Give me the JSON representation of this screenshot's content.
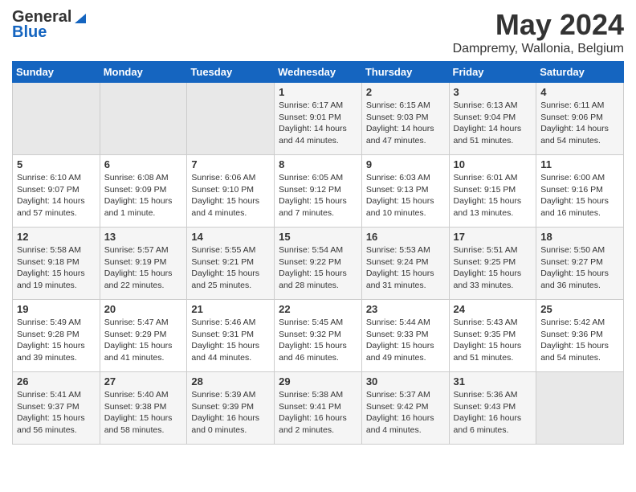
{
  "header": {
    "logo_general": "General",
    "logo_blue": "Blue",
    "month_title": "May 2024",
    "subtitle": "Dampremy, Wallonia, Belgium"
  },
  "weekdays": [
    "Sunday",
    "Monday",
    "Tuesday",
    "Wednesday",
    "Thursday",
    "Friday",
    "Saturday"
  ],
  "weeks": [
    [
      {
        "day": "",
        "info": ""
      },
      {
        "day": "",
        "info": ""
      },
      {
        "day": "",
        "info": ""
      },
      {
        "day": "1",
        "info": "Sunrise: 6:17 AM\nSunset: 9:01 PM\nDaylight: 14 hours and 44 minutes."
      },
      {
        "day": "2",
        "info": "Sunrise: 6:15 AM\nSunset: 9:03 PM\nDaylight: 14 hours and 47 minutes."
      },
      {
        "day": "3",
        "info": "Sunrise: 6:13 AM\nSunset: 9:04 PM\nDaylight: 14 hours and 51 minutes."
      },
      {
        "day": "4",
        "info": "Sunrise: 6:11 AM\nSunset: 9:06 PM\nDaylight: 14 hours and 54 minutes."
      }
    ],
    [
      {
        "day": "5",
        "info": "Sunrise: 6:10 AM\nSunset: 9:07 PM\nDaylight: 14 hours and 57 minutes."
      },
      {
        "day": "6",
        "info": "Sunrise: 6:08 AM\nSunset: 9:09 PM\nDaylight: 15 hours and 1 minute."
      },
      {
        "day": "7",
        "info": "Sunrise: 6:06 AM\nSunset: 9:10 PM\nDaylight: 15 hours and 4 minutes."
      },
      {
        "day": "8",
        "info": "Sunrise: 6:05 AM\nSunset: 9:12 PM\nDaylight: 15 hours and 7 minutes."
      },
      {
        "day": "9",
        "info": "Sunrise: 6:03 AM\nSunset: 9:13 PM\nDaylight: 15 hours and 10 minutes."
      },
      {
        "day": "10",
        "info": "Sunrise: 6:01 AM\nSunset: 9:15 PM\nDaylight: 15 hours and 13 minutes."
      },
      {
        "day": "11",
        "info": "Sunrise: 6:00 AM\nSunset: 9:16 PM\nDaylight: 15 hours and 16 minutes."
      }
    ],
    [
      {
        "day": "12",
        "info": "Sunrise: 5:58 AM\nSunset: 9:18 PM\nDaylight: 15 hours and 19 minutes."
      },
      {
        "day": "13",
        "info": "Sunrise: 5:57 AM\nSunset: 9:19 PM\nDaylight: 15 hours and 22 minutes."
      },
      {
        "day": "14",
        "info": "Sunrise: 5:55 AM\nSunset: 9:21 PM\nDaylight: 15 hours and 25 minutes."
      },
      {
        "day": "15",
        "info": "Sunrise: 5:54 AM\nSunset: 9:22 PM\nDaylight: 15 hours and 28 minutes."
      },
      {
        "day": "16",
        "info": "Sunrise: 5:53 AM\nSunset: 9:24 PM\nDaylight: 15 hours and 31 minutes."
      },
      {
        "day": "17",
        "info": "Sunrise: 5:51 AM\nSunset: 9:25 PM\nDaylight: 15 hours and 33 minutes."
      },
      {
        "day": "18",
        "info": "Sunrise: 5:50 AM\nSunset: 9:27 PM\nDaylight: 15 hours and 36 minutes."
      }
    ],
    [
      {
        "day": "19",
        "info": "Sunrise: 5:49 AM\nSunset: 9:28 PM\nDaylight: 15 hours and 39 minutes."
      },
      {
        "day": "20",
        "info": "Sunrise: 5:47 AM\nSunset: 9:29 PM\nDaylight: 15 hours and 41 minutes."
      },
      {
        "day": "21",
        "info": "Sunrise: 5:46 AM\nSunset: 9:31 PM\nDaylight: 15 hours and 44 minutes."
      },
      {
        "day": "22",
        "info": "Sunrise: 5:45 AM\nSunset: 9:32 PM\nDaylight: 15 hours and 46 minutes."
      },
      {
        "day": "23",
        "info": "Sunrise: 5:44 AM\nSunset: 9:33 PM\nDaylight: 15 hours and 49 minutes."
      },
      {
        "day": "24",
        "info": "Sunrise: 5:43 AM\nSunset: 9:35 PM\nDaylight: 15 hours and 51 minutes."
      },
      {
        "day": "25",
        "info": "Sunrise: 5:42 AM\nSunset: 9:36 PM\nDaylight: 15 hours and 54 minutes."
      }
    ],
    [
      {
        "day": "26",
        "info": "Sunrise: 5:41 AM\nSunset: 9:37 PM\nDaylight: 15 hours and 56 minutes."
      },
      {
        "day": "27",
        "info": "Sunrise: 5:40 AM\nSunset: 9:38 PM\nDaylight: 15 hours and 58 minutes."
      },
      {
        "day": "28",
        "info": "Sunrise: 5:39 AM\nSunset: 9:39 PM\nDaylight: 16 hours and 0 minutes."
      },
      {
        "day": "29",
        "info": "Sunrise: 5:38 AM\nSunset: 9:41 PM\nDaylight: 16 hours and 2 minutes."
      },
      {
        "day": "30",
        "info": "Sunrise: 5:37 AM\nSunset: 9:42 PM\nDaylight: 16 hours and 4 minutes."
      },
      {
        "day": "31",
        "info": "Sunrise: 5:36 AM\nSunset: 9:43 PM\nDaylight: 16 hours and 6 minutes."
      },
      {
        "day": "",
        "info": ""
      }
    ]
  ]
}
